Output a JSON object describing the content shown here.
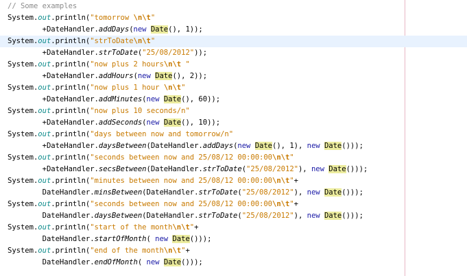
{
  "editor": {
    "colors": {
      "background": "#ffffff",
      "current_line": "#e8f2fe",
      "highlight": "#ecec9e",
      "string": "#c87a00",
      "keyword": "#1a1aa6",
      "field": "#0e8b8b",
      "comment": "#8c8c8c",
      "margin_line": "#e8b7c4"
    },
    "current_line_index": 3,
    "lines": [
      [
        {
          "t": "// Some examples",
          "c": "comment"
        }
      ],
      [
        {
          "t": "System."
        },
        {
          "t": "out",
          "c": "field"
        },
        {
          "t": ".println("
        },
        {
          "t": "\"tomorrow ",
          "c": "str"
        },
        {
          "t": "\\n\\t",
          "c": "str esc"
        },
        {
          "t": "\"",
          "c": "str"
        }
      ],
      [
        {
          "t": "        +DateHandler."
        },
        {
          "t": "addDays",
          "c": "method"
        },
        {
          "t": "("
        },
        {
          "t": "new",
          "c": "kw"
        },
        {
          "t": " "
        },
        {
          "t": "Date",
          "c": "hl"
        },
        {
          "t": "(), 1));"
        }
      ],
      [
        {
          "t": "System."
        },
        {
          "t": "out",
          "c": "field"
        },
        {
          "t": ".println("
        },
        {
          "t": "\"strToDate",
          "c": "str"
        },
        {
          "t": "\\n\\t",
          "c": "str esc"
        },
        {
          "t": "\"",
          "c": "str"
        }
      ],
      [
        {
          "t": "        +DateHandler."
        },
        {
          "t": "strToDate",
          "c": "method"
        },
        {
          "t": "("
        },
        {
          "t": "\"25/08/2012\"",
          "c": "str"
        },
        {
          "t": "));"
        }
      ],
      [
        {
          "t": "System."
        },
        {
          "t": "out",
          "c": "field"
        },
        {
          "t": ".println("
        },
        {
          "t": "\"now plus 2 hours",
          "c": "str"
        },
        {
          "t": "\\n\\t",
          "c": "str esc"
        },
        {
          "t": " \"",
          "c": "str"
        }
      ],
      [
        {
          "t": "        +DateHandler."
        },
        {
          "t": "addHours",
          "c": "method"
        },
        {
          "t": "("
        },
        {
          "t": "new",
          "c": "kw"
        },
        {
          "t": " "
        },
        {
          "t": "Date",
          "c": "hl"
        },
        {
          "t": "(), 2));"
        }
      ],
      [
        {
          "t": "System."
        },
        {
          "t": "out",
          "c": "field"
        },
        {
          "t": ".println("
        },
        {
          "t": "\"now plus 1 hour ",
          "c": "str"
        },
        {
          "t": "\\n\\t",
          "c": "str esc"
        },
        {
          "t": "\"",
          "c": "str"
        }
      ],
      [
        {
          "t": "        +DateHandler."
        },
        {
          "t": "addMinutes",
          "c": "method"
        },
        {
          "t": "("
        },
        {
          "t": "new",
          "c": "kw"
        },
        {
          "t": " "
        },
        {
          "t": "Date",
          "c": "hl"
        },
        {
          "t": "(), 60));"
        }
      ],
      [
        {
          "t": "System."
        },
        {
          "t": "out",
          "c": "field"
        },
        {
          "t": ".println("
        },
        {
          "t": "\"now plus 10 seconds/n\"",
          "c": "str"
        }
      ],
      [
        {
          "t": "        +DateHandler."
        },
        {
          "t": "addSeconds",
          "c": "method"
        },
        {
          "t": "("
        },
        {
          "t": "new",
          "c": "kw"
        },
        {
          "t": " "
        },
        {
          "t": "Date",
          "c": "hl"
        },
        {
          "t": "(), 10));"
        }
      ],
      [
        {
          "t": "System."
        },
        {
          "t": "out",
          "c": "field"
        },
        {
          "t": ".println("
        },
        {
          "t": "\"days between now and tomorrow/n\"",
          "c": "str"
        }
      ],
      [
        {
          "t": "        +DateHandler."
        },
        {
          "t": "daysBetween",
          "c": "method"
        },
        {
          "t": "(DateHandler."
        },
        {
          "t": "addDays",
          "c": "method"
        },
        {
          "t": "("
        },
        {
          "t": "new",
          "c": "kw"
        },
        {
          "t": " "
        },
        {
          "t": "Date",
          "c": "hl"
        },
        {
          "t": "(), 1), "
        },
        {
          "t": "new",
          "c": "kw"
        },
        {
          "t": " "
        },
        {
          "t": "Date",
          "c": "hl"
        },
        {
          "t": "()));"
        }
      ],
      [
        {
          "t": "System."
        },
        {
          "t": "out",
          "c": "field"
        },
        {
          "t": ".println("
        },
        {
          "t": "\"seconds between now and 25/08/12 00:00:00",
          "c": "str"
        },
        {
          "t": "\\n\\t",
          "c": "str esc"
        },
        {
          "t": "\"",
          "c": "str"
        }
      ],
      [
        {
          "t": "        +DateHandler."
        },
        {
          "t": "secsBetween",
          "c": "method"
        },
        {
          "t": "(DateHandler."
        },
        {
          "t": "strToDate",
          "c": "method"
        },
        {
          "t": "("
        },
        {
          "t": "\"25/08/2012\"",
          "c": "str"
        },
        {
          "t": "), "
        },
        {
          "t": "new",
          "c": "kw"
        },
        {
          "t": " "
        },
        {
          "t": "Date",
          "c": "hl"
        },
        {
          "t": "()));"
        }
      ],
      [
        {
          "t": "System."
        },
        {
          "t": "out",
          "c": "field"
        },
        {
          "t": ".println("
        },
        {
          "t": "\"minutes between now and 25/08/12 00:00:00",
          "c": "str"
        },
        {
          "t": "\\n\\t",
          "c": "str esc"
        },
        {
          "t": "\"",
          "c": "str"
        },
        {
          "t": "+"
        }
      ],
      [
        {
          "t": "        DateHandler."
        },
        {
          "t": "minsBetween",
          "c": "method"
        },
        {
          "t": "(DateHandler."
        },
        {
          "t": "strToDate",
          "c": "method"
        },
        {
          "t": "("
        },
        {
          "t": "\"25/08/2012\"",
          "c": "str"
        },
        {
          "t": "), "
        },
        {
          "t": "new",
          "c": "kw"
        },
        {
          "t": " "
        },
        {
          "t": "Date",
          "c": "hl"
        },
        {
          "t": "()));"
        }
      ],
      [
        {
          "t": "System."
        },
        {
          "t": "out",
          "c": "field"
        },
        {
          "t": ".println("
        },
        {
          "t": "\"seconds between now and 25/08/12 00:00:00",
          "c": "str"
        },
        {
          "t": "\\n\\t",
          "c": "str esc"
        },
        {
          "t": "\"",
          "c": "str"
        },
        {
          "t": "+"
        }
      ],
      [
        {
          "t": "        DateHandler."
        },
        {
          "t": "daysBetween",
          "c": "method"
        },
        {
          "t": "(DateHandler."
        },
        {
          "t": "strToDate",
          "c": "method"
        },
        {
          "t": "("
        },
        {
          "t": "\"25/08/2012\"",
          "c": "str"
        },
        {
          "t": "), "
        },
        {
          "t": "new",
          "c": "kw"
        },
        {
          "t": " "
        },
        {
          "t": "Date",
          "c": "hl"
        },
        {
          "t": "()));"
        }
      ],
      [
        {
          "t": "System."
        },
        {
          "t": "out",
          "c": "field"
        },
        {
          "t": ".println("
        },
        {
          "t": "\"start of the month",
          "c": "str"
        },
        {
          "t": "\\n\\t",
          "c": "str esc"
        },
        {
          "t": "\"",
          "c": "str"
        },
        {
          "t": "+"
        }
      ],
      [
        {
          "t": "        DateHandler."
        },
        {
          "t": "startOfMonth",
          "c": "method"
        },
        {
          "t": "( "
        },
        {
          "t": "new",
          "c": "kw"
        },
        {
          "t": " "
        },
        {
          "t": "Date",
          "c": "hl"
        },
        {
          "t": "()));"
        }
      ],
      [
        {
          "t": "System."
        },
        {
          "t": "out",
          "c": "field"
        },
        {
          "t": ".println("
        },
        {
          "t": "\"end of the month",
          "c": "str"
        },
        {
          "t": "\\n\\t",
          "c": "str esc"
        },
        {
          "t": "\"",
          "c": "str"
        },
        {
          "t": "+"
        }
      ],
      [
        {
          "t": "        DateHandler."
        },
        {
          "t": "endOfMonth",
          "c": "method"
        },
        {
          "t": "( "
        },
        {
          "t": "new",
          "c": "kw"
        },
        {
          "t": " "
        },
        {
          "t": "Date",
          "c": "hl"
        },
        {
          "t": "()));"
        }
      ]
    ]
  }
}
